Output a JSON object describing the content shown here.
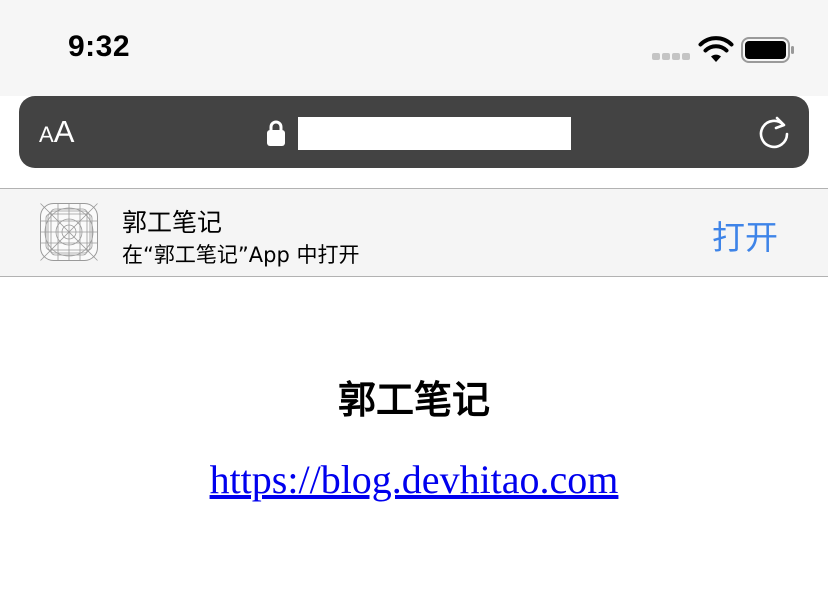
{
  "status_bar": {
    "time": "9:32",
    "signal_icon": "cellular-signal-icon",
    "wifi_icon": "wifi-icon",
    "battery_icon": "battery-icon"
  },
  "address_bar": {
    "text_size_small": "A",
    "text_size_large": "A",
    "lock_icon": "lock-icon",
    "reload_icon": "reload-icon",
    "background_color": "#434343"
  },
  "app_banner": {
    "app_icon": "app-placeholder-icon",
    "app_name": "郭工笔记",
    "subtitle": "在“郭工笔记”App 中打开",
    "open_label": "打开",
    "accent_color": "#3e84e8"
  },
  "page": {
    "title": "郭工笔记",
    "link": "https://blog.devhitao.com",
    "link_color": "#0000ee"
  }
}
